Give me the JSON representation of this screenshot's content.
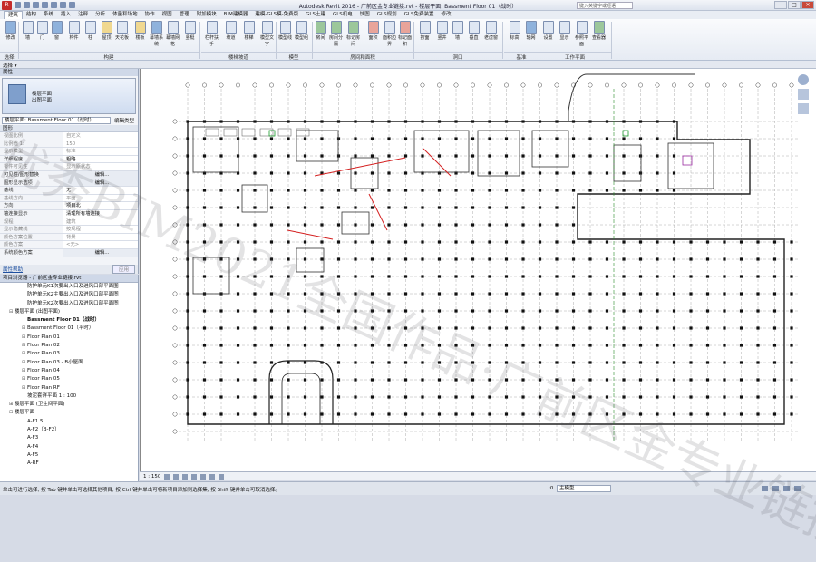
{
  "app": {
    "menu_button": "R",
    "title": "Autodesk Revit 2016 -    广前区金专业链接.rvt - 楼层平面: Bassment Floor 01（战时）",
    "search_placeholder": "键入关键字或短语",
    "window_buttons": [
      "–",
      "□",
      "✕"
    ]
  },
  "tabs": [
    "建筑",
    "结构",
    "系统",
    "插入",
    "注释",
    "分析",
    "体量和场地",
    "协作",
    "视图",
    "管理",
    "附加模块",
    "BIM建模器",
    "建模-GLS模-免费版",
    "GLS土建",
    "GLS机电",
    "快图",
    "GLS规划",
    "GLS免费装置",
    "修改"
  ],
  "ribbon": {
    "buttons": [
      {
        "label": "修改",
        "icon": "modify-icon",
        "c": "blue"
      },
      {
        "label": "墙",
        "icon": "wall-icon",
        "c": ""
      },
      {
        "label": "门",
        "icon": "door-icon",
        "c": ""
      },
      {
        "label": "窗",
        "icon": "window-icon",
        "c": "blue"
      },
      {
        "label": "构件",
        "icon": "component-icon",
        "c": ""
      },
      {
        "label": "柱",
        "icon": "column-icon",
        "c": ""
      },
      {
        "label": "屋顶",
        "icon": "roof-icon",
        "c": "yel"
      },
      {
        "label": "天花板",
        "icon": "ceiling-icon",
        "c": ""
      },
      {
        "label": "楼板",
        "icon": "floor-icon",
        "c": "yel"
      },
      {
        "label": "幕墙系统",
        "icon": "curtain-system-icon",
        "c": "blue"
      },
      {
        "label": "幕墙网格",
        "icon": "curtain-grid-icon",
        "c": ""
      },
      {
        "label": "竖梃",
        "icon": "mullion-icon",
        "c": ""
      },
      {
        "label": "栏杆扶手",
        "icon": "railing-icon",
        "c": ""
      },
      {
        "label": "坡道",
        "icon": "ramp-icon",
        "c": ""
      },
      {
        "label": "楼梯",
        "icon": "stair-icon",
        "c": ""
      },
      {
        "label": "模型文字",
        "icon": "model-text-icon",
        "c": ""
      },
      {
        "label": "模型线",
        "icon": "model-line-icon",
        "c": ""
      },
      {
        "label": "模型组",
        "icon": "model-group-icon",
        "c": ""
      },
      {
        "label": "房间",
        "icon": "room-icon",
        "c": "grn"
      },
      {
        "label": "房间分隔",
        "icon": "room-separator-icon",
        "c": "grn"
      },
      {
        "label": "标记房间",
        "icon": "tag-room-icon",
        "c": "grn"
      },
      {
        "label": "面积",
        "icon": "area-icon",
        "c": "red"
      },
      {
        "label": "面积边界",
        "icon": "area-boundary-icon",
        "c": ""
      },
      {
        "label": "标记面积",
        "icon": "tag-area-icon",
        "c": "red"
      },
      {
        "label": "按面",
        "icon": "by-face-icon",
        "c": ""
      },
      {
        "label": "竖井",
        "icon": "shaft-icon",
        "c": ""
      },
      {
        "label": "墙",
        "icon": "wall-opening-icon",
        "c": ""
      },
      {
        "label": "垂直",
        "icon": "vertical-opening-icon",
        "c": ""
      },
      {
        "label": "老虎窗",
        "icon": "dormer-icon",
        "c": ""
      },
      {
        "label": "标高",
        "icon": "level-icon",
        "c": ""
      },
      {
        "label": "轴网",
        "icon": "grid-icon",
        "c": "blue"
      },
      {
        "label": "设置",
        "icon": "set-icon",
        "c": ""
      },
      {
        "label": "显示",
        "icon": "show-icon",
        "c": ""
      },
      {
        "label": "参照平面",
        "icon": "ref-plane-icon",
        "c": ""
      },
      {
        "label": "查看器",
        "icon": "viewer-icon",
        "c": "grn"
      }
    ],
    "groups": [
      "选择",
      "构建",
      "楼梯坡道",
      "模型",
      "房间和面积",
      "洞口",
      "基准",
      "工作平面"
    ]
  },
  "options": {
    "select": "选择 ▾",
    "modify": "属性"
  },
  "properties": {
    "header": "属性",
    "type_name": "楼层平面\n出图平面",
    "selector": "楼层平面: Bassment Floor 01（战时）",
    "edit_type": "编辑类型",
    "group": "图形",
    "rows": [
      {
        "k": "视图比例",
        "v": "自定义",
        "dim": true
      },
      {
        "k": "比例值 1:",
        "v": "150",
        "dim": true
      },
      {
        "k": "显示模型",
        "v": "标准",
        "dim": true
      },
      {
        "k": "详细程度",
        "v": "粗略",
        "dim": false
      },
      {
        "k": "零件可见性",
        "v": "显示原状态",
        "dim": true
      },
      {
        "k": "可见性/图形替换",
        "v": "编辑...",
        "dim": false,
        "btn": true
      },
      {
        "k": "图形显示选项",
        "v": "编辑...",
        "dim": false,
        "btn": true
      },
      {
        "k": "基线",
        "v": "无",
        "dim": false
      },
      {
        "k": "基线方向",
        "v": "平面",
        "dim": true
      },
      {
        "k": "方向",
        "v": "项目北",
        "dim": false
      },
      {
        "k": "墙连接显示",
        "v": "清理所有墙连接",
        "dim": false
      },
      {
        "k": "规程",
        "v": "建筑",
        "dim": true
      },
      {
        "k": "显示隐藏线",
        "v": "按规程",
        "dim": true
      },
      {
        "k": "颜色方案位置",
        "v": "背景",
        "dim": true
      },
      {
        "k": "颜色方案",
        "v": "<无>",
        "dim": true
      },
      {
        "k": "系统颜色方案",
        "v": "编辑...",
        "dim": false,
        "btn": true
      }
    ],
    "help": "属性帮助",
    "apply": "应用"
  },
  "browser": {
    "header": "项目浏览器 - 广前区金专业链接.rvt",
    "items": [
      {
        "t": "防护单元K1次要出入口及进风口部平面图",
        "ind": 30,
        "tg": "",
        "b": false
      },
      {
        "t": "防护单元K2主要出入口及进风口部平面图",
        "ind": 30,
        "tg": "",
        "b": false
      },
      {
        "t": "防护单元K2次要出入口及进风口部平面图",
        "ind": 30,
        "tg": "",
        "b": false
      },
      {
        "t": "楼层平面 (出图平面)",
        "ind": 10,
        "tg": "⊟",
        "b": false
      },
      {
        "t": "Bassment Floor 01（战时）",
        "ind": 30,
        "tg": "",
        "b": true
      },
      {
        "t": "Bassment Floor 01（平时）",
        "ind": 24,
        "tg": "⊞",
        "b": false
      },
      {
        "t": "Floor Plan 01",
        "ind": 24,
        "tg": "⊞",
        "b": false
      },
      {
        "t": "Floor Plan 02",
        "ind": 24,
        "tg": "⊞",
        "b": false
      },
      {
        "t": "Floor Plan 03",
        "ind": 24,
        "tg": "⊞",
        "b": false
      },
      {
        "t": "Floor Plan 03 - B小屋面",
        "ind": 24,
        "tg": "⊞",
        "b": false
      },
      {
        "t": "Floor Plan 04",
        "ind": 24,
        "tg": "⊞",
        "b": false
      },
      {
        "t": "Floor Plan 05",
        "ind": 24,
        "tg": "⊞",
        "b": false
      },
      {
        "t": "Floor Plan RF",
        "ind": 24,
        "tg": "⊞",
        "b": false
      },
      {
        "t": "坡泥套详平面 1 : 100",
        "ind": 30,
        "tg": "",
        "b": false
      },
      {
        "t": "楼层平面 (卫生间平面)",
        "ind": 10,
        "tg": "⊞",
        "b": false
      },
      {
        "t": "楼层平面",
        "ind": 10,
        "tg": "⊟",
        "b": false
      },
      {
        "t": "A-F1.5",
        "ind": 30,
        "tg": "",
        "b": false
      },
      {
        "t": "A-F2（B-F2）",
        "ind": 30,
        "tg": "",
        "b": false
      },
      {
        "t": "A-F3",
        "ind": 30,
        "tg": "",
        "b": false
      },
      {
        "t": "A-F4",
        "ind": 30,
        "tg": "",
        "b": false
      },
      {
        "t": "A-F5",
        "ind": 30,
        "tg": "",
        "b": false
      },
      {
        "t": "A-RF",
        "ind": 30,
        "tg": "",
        "b": false
      }
    ]
  },
  "viewbar": {
    "scale": "1 : 150"
  },
  "status": {
    "message": "单击可进行选择; 按 Tab 键并单击可选择其他项目; 按 Ctrl 键并单击可将新项目添加到选择集; 按 Shift 键并单击可取消选择。",
    "zero": ":0",
    "model": "主模型"
  },
  "watermark": "优秀BIM2021全国作品·广前区金专业链接"
}
